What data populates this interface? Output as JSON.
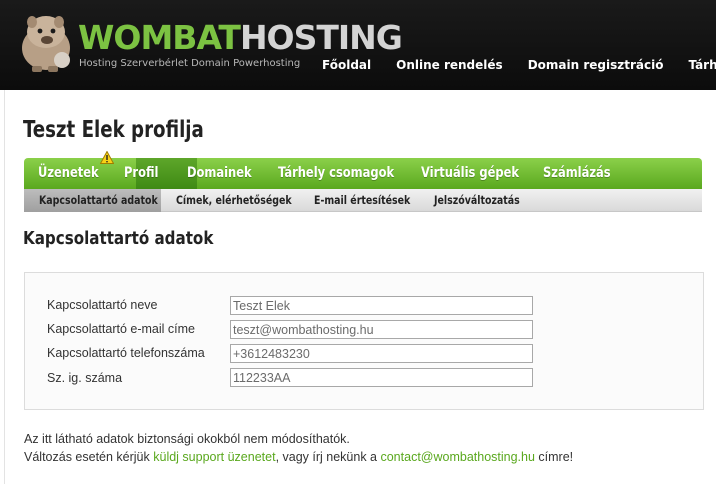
{
  "colors": {
    "brand_green": "#7cc242",
    "header_bg": "#111111",
    "link_green": "#5aa81e"
  },
  "header": {
    "logo": {
      "word1": "WOMBAT",
      "word2": "HOSTING",
      "tagline": "Hosting Szerverbérlet Domain Powerhosting",
      "mascot_icon": "wombat-mascot-icon"
    },
    "nav": [
      {
        "label": "Főoldal"
      },
      {
        "label": "Online rendelés"
      },
      {
        "label": "Domain regisztráció"
      },
      {
        "label": "Tárhely cso"
      }
    ]
  },
  "page": {
    "title": "Teszt Elek profilja"
  },
  "tabs": [
    {
      "label": "Üzenetek",
      "active": false,
      "icon": "warning-icon"
    },
    {
      "label": "Profil",
      "active": true
    },
    {
      "label": "Domainek",
      "active": false
    },
    {
      "label": "Tárhely csomagok",
      "active": false
    },
    {
      "label": "Virtuális gépek",
      "active": false
    },
    {
      "label": "Számlázás",
      "active": false
    }
  ],
  "subtabs": [
    {
      "label": "Kapcsolattartó adatok",
      "active": true
    },
    {
      "label": "Címek, elérhetőségek",
      "active": false
    },
    {
      "label": "E-mail értesítések",
      "active": false
    },
    {
      "label": "Jelszóváltozatás",
      "active": false
    }
  ],
  "section": {
    "title": "Kapcsolattartó adatok"
  },
  "form": [
    {
      "label": "Kapcsolattartó neve",
      "value": "Teszt Elek"
    },
    {
      "label": "Kapcsolattartó e-mail címe",
      "value": "teszt@wombathosting.hu"
    },
    {
      "label": "Kapcsolattartó telefonszáma",
      "value": "+3612483230"
    },
    {
      "label": "Sz. ig. száma",
      "value": "112233AA"
    }
  ],
  "footer_note": {
    "line1": "Az itt látható adatok biztonsági okokból nem módosíthatók.",
    "line2_prefix": "Változás esetén kérjük ",
    "support_link": "küldj support üzenetet",
    "line2_middle": ", vagy írj nekünk a ",
    "email_link": "contact@wombathosting.hu",
    "line2_suffix": " címre!"
  }
}
